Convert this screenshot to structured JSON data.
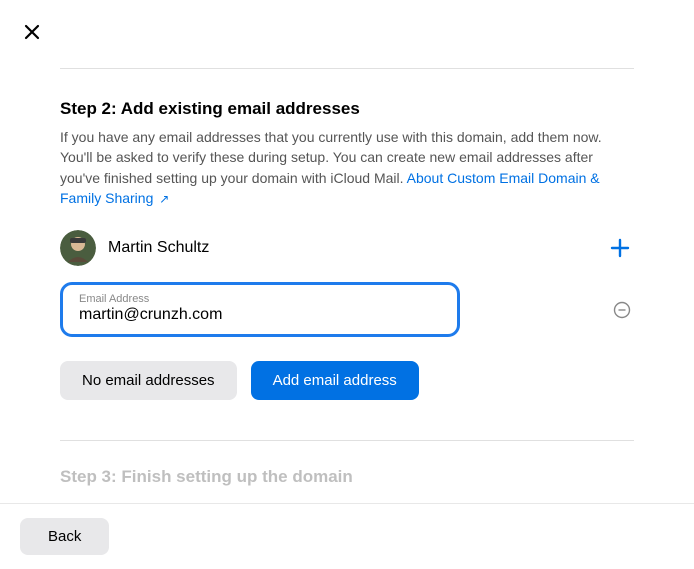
{
  "step2": {
    "title": "Step 2: Add existing email addresses",
    "description": "If you have any email addresses that you currently use with this domain, add them now. You'll be asked to verify these during setup. You can create new email addresses after you've finished setting up your domain with iCloud Mail. ",
    "link_text": "About Custom Email Domain & Family Sharing",
    "link_arrow": "↗"
  },
  "user": {
    "name": "Martin Schultz"
  },
  "email_input": {
    "label": "Email Address",
    "value": "martin@crunzh.com"
  },
  "buttons": {
    "no_email": "No email addresses",
    "add_email": "Add email address",
    "back": "Back"
  },
  "step3": {
    "title": "Step 3: Finish setting up the domain"
  },
  "icons": {
    "close": "close",
    "plus": "plus",
    "remove": "minus-circle"
  }
}
